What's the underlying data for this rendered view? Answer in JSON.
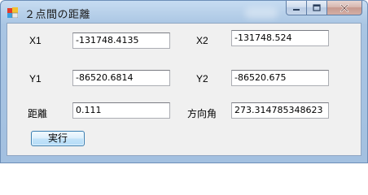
{
  "window": {
    "title": "２点間の距離"
  },
  "caption_buttons": {
    "minimize_icon": "minimize-icon",
    "maximize_icon": "maximize-icon",
    "close_icon": "close-icon"
  },
  "fields": {
    "x1": {
      "label": "X1",
      "value": "-131748.4135"
    },
    "x2": {
      "label": "X2",
      "value": "-131748.524"
    },
    "y1": {
      "label": "Y1",
      "value": "-86520.6814"
    },
    "y2": {
      "label": "Y2",
      "value": "-86520.675"
    },
    "distance": {
      "label": "距離",
      "value": "0.111"
    },
    "bearing": {
      "label": "方向角",
      "value": "273.314785348623"
    }
  },
  "actions": {
    "run_label": "実行"
  }
}
